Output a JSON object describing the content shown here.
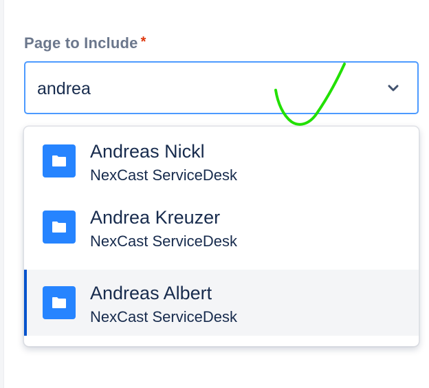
{
  "field": {
    "label": "Page to Include",
    "required_marker": "*",
    "input_value": "andrea",
    "chevron_icon": "chevron-down-icon"
  },
  "dropdown": {
    "options": [
      {
        "title": "Andreas Nickl",
        "space": "NexCast ServiceDesk",
        "icon": "folder-icon",
        "selected": false
      },
      {
        "title": "Andrea Kreuzer",
        "space": "NexCast ServiceDesk",
        "icon": "folder-icon",
        "selected": false
      },
      {
        "title": "Andreas Albert",
        "space": "NexCast ServiceDesk",
        "icon": "folder-icon",
        "selected": true
      }
    ]
  },
  "colors": {
    "accent_border": "#4c9aff",
    "selected_bar": "#0052cc",
    "icon_bg": "#2684ff",
    "required": "#de350b",
    "annotation_stroke": "#22e000"
  }
}
